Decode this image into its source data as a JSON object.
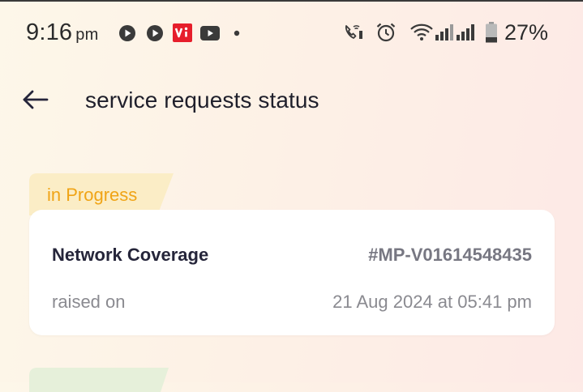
{
  "status_bar": {
    "time": "9:16",
    "ampm": "pm",
    "battery_percent": "27%",
    "left_icons": [
      "play-circle-icon",
      "play-circle-icon",
      "vi-app-icon",
      "youtube-icon",
      "notification-dot-icon"
    ],
    "right_icons": [
      "wifi-calling-icon",
      "alarm-icon",
      "wifi-icon",
      "signal-icon",
      "signal-icon",
      "battery-icon"
    ]
  },
  "app_bar": {
    "title": "service requests status"
  },
  "requests": [
    {
      "status": "in Progress",
      "status_color": "#f0a416",
      "status_bg": "#fbedc6",
      "title": "Network Coverage",
      "id": "#MP-V01614548435",
      "raised_label": "raised on",
      "raised_date": "21 Aug 2024 at 05:41 pm"
    }
  ],
  "colors": {
    "next_status_bg": "#e6f0da",
    "vi_brand": "#e61e2b"
  }
}
